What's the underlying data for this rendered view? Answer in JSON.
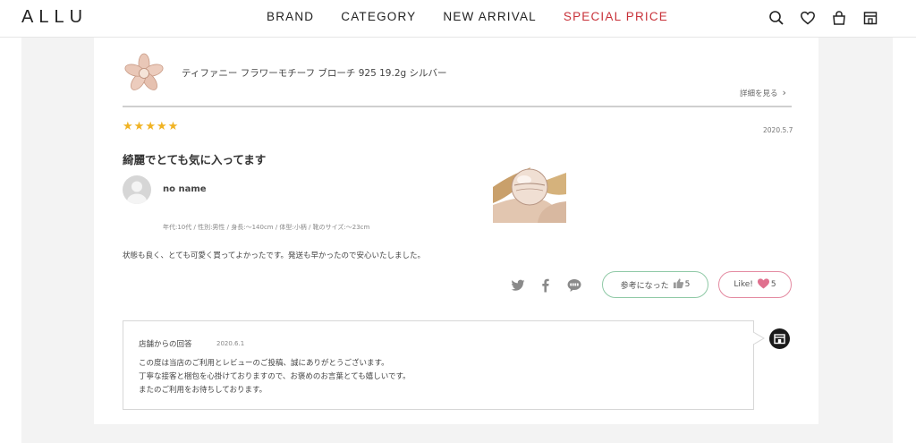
{
  "header": {
    "logo": "ALLU",
    "menu": [
      {
        "label": "BRAND"
      },
      {
        "label": "CATEGORY"
      },
      {
        "label": "NEW ARRIVAL"
      },
      {
        "label": "SPECIAL PRICE"
      }
    ],
    "icons": [
      "search-icon",
      "heart-icon",
      "bag-icon",
      "store-icon"
    ],
    "accent_color": "#c8323a"
  },
  "product": {
    "name": "ティファニー フラワーモチーフ ブローチ 925 19.2g シルバー",
    "detail_link": "詳細を見る"
  },
  "review": {
    "rating": 5,
    "rating_max": 5,
    "date": "2020.5.7",
    "title": "綺麗でとても気に入ってます",
    "user_name": "no name",
    "user_attrs": "年代:10代 / 性別:男性 / 身長:〜140cm / 体型:小柄 / 靴のサイズ:〜23cm",
    "body": "状態も良く、とても可愛く買ってよかったです。発送も早かったので安心いたしました。",
    "star_color": "#f0b323"
  },
  "actions": {
    "helpful_label": "参考になった",
    "helpful_count": "5",
    "like_label": "Like!",
    "like_count": "5",
    "share_icons": [
      "twitter-icon",
      "facebook-icon",
      "line-icon"
    ]
  },
  "reply": {
    "heading": "店舗からの回答",
    "date": "2020.6.1",
    "lines": [
      "この度は当店のご利用とレビューのご投稿、誠にありがとうございます。",
      "丁寧な接客と梱包を心掛けておりますので、お褒めのお言葉とても嬉しいです。",
      "またのご利用をお待ちしております。"
    ]
  }
}
